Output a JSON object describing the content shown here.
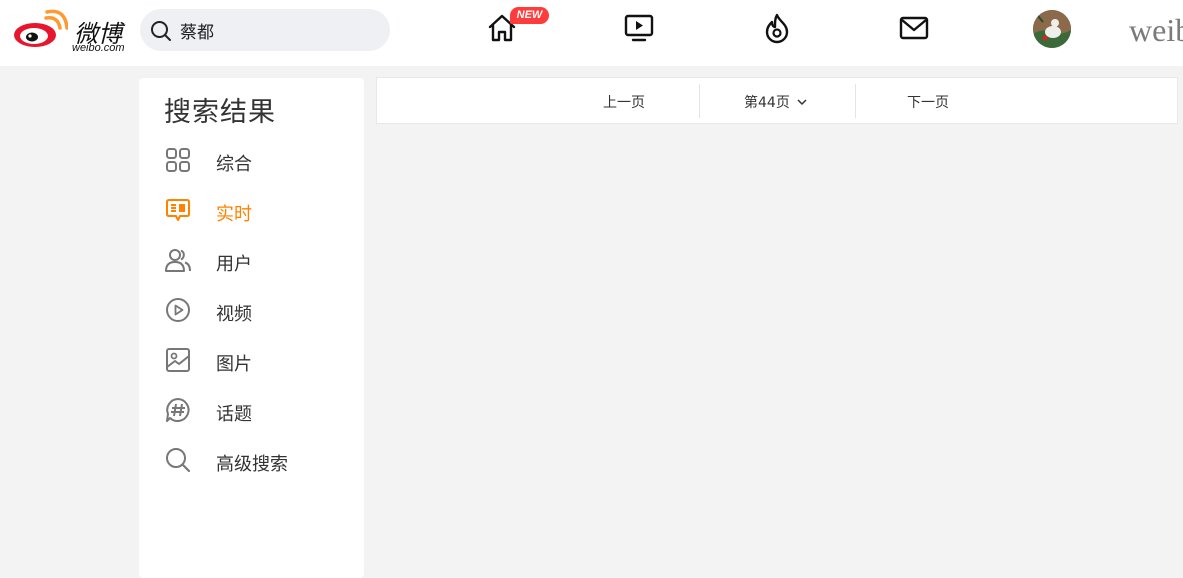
{
  "header": {
    "logo_text": "微博",
    "logo_sub": "weibo.com",
    "search_value": "蔡都",
    "new_badge": "NEW",
    "brand_text": "weib",
    "icons": [
      "home-icon",
      "video-icon",
      "hot-icon",
      "mail-icon"
    ]
  },
  "sidebar": {
    "title": "搜索结果",
    "items": [
      {
        "label": "综合",
        "icon": "grid-icon"
      },
      {
        "label": "实时",
        "icon": "realtime-icon",
        "active": true
      },
      {
        "label": "用户",
        "icon": "users-icon"
      },
      {
        "label": "视频",
        "icon": "play-icon"
      },
      {
        "label": "图片",
        "icon": "image-icon"
      },
      {
        "label": "话题",
        "icon": "hashtag-icon"
      },
      {
        "label": "高级搜索",
        "icon": "search-icon"
      }
    ]
  },
  "pager": {
    "prev_label": "上一页",
    "current_label": "第44页",
    "next_label": "下一页"
  },
  "colors": {
    "accent": "#ff8200",
    "badge": "#ff3b3b",
    "background": "#f3f3f3"
  }
}
